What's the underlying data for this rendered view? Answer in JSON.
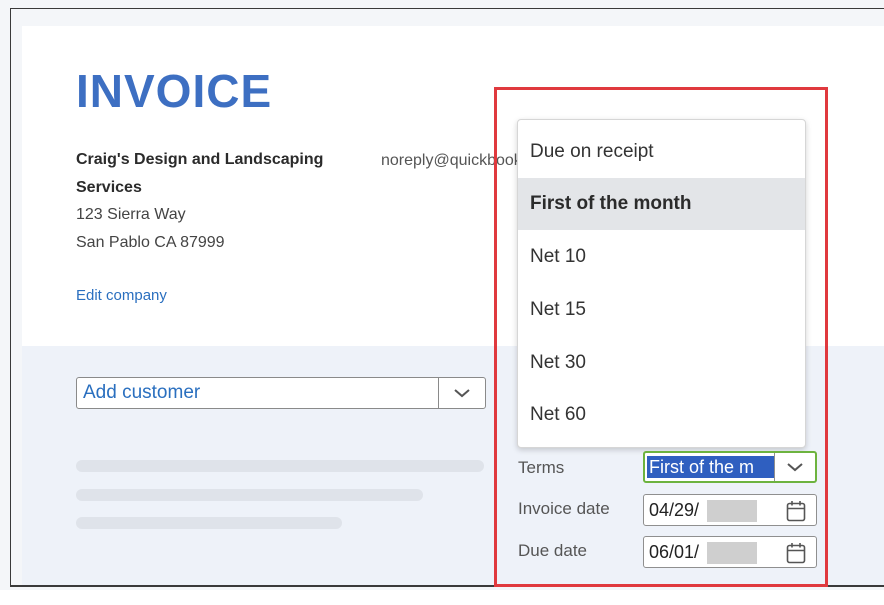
{
  "invoice": {
    "title": "INVOICE",
    "company_name_line1": "Craig's Design and Landscaping",
    "company_name_line2": "Services",
    "email": "noreply@quickbooks.com",
    "address_line1": "123 Sierra Way",
    "address_line2": "San Pablo CA 87999",
    "edit_company_link": "Edit company"
  },
  "customer": {
    "placeholder": "Add customer"
  },
  "terms_dropdown": {
    "options": [
      "Due on receipt",
      "First of the month",
      "Net 10",
      "Net 15",
      "Net 30",
      "Net 60"
    ],
    "selected": "First of the month"
  },
  "fields": {
    "terms_label": "Terms",
    "terms_value": "First of the m",
    "invoice_date_label": "Invoice date",
    "invoice_date_value": "04/29/",
    "due_date_label": "Due date",
    "due_date_value": "06/01/"
  },
  "colors": {
    "title_blue": "#3d6fc2",
    "link_blue": "#2a6fbf",
    "highlight_red": "#e0393e",
    "focus_green": "#6db33f",
    "selection_blue": "#2f5fc0"
  }
}
